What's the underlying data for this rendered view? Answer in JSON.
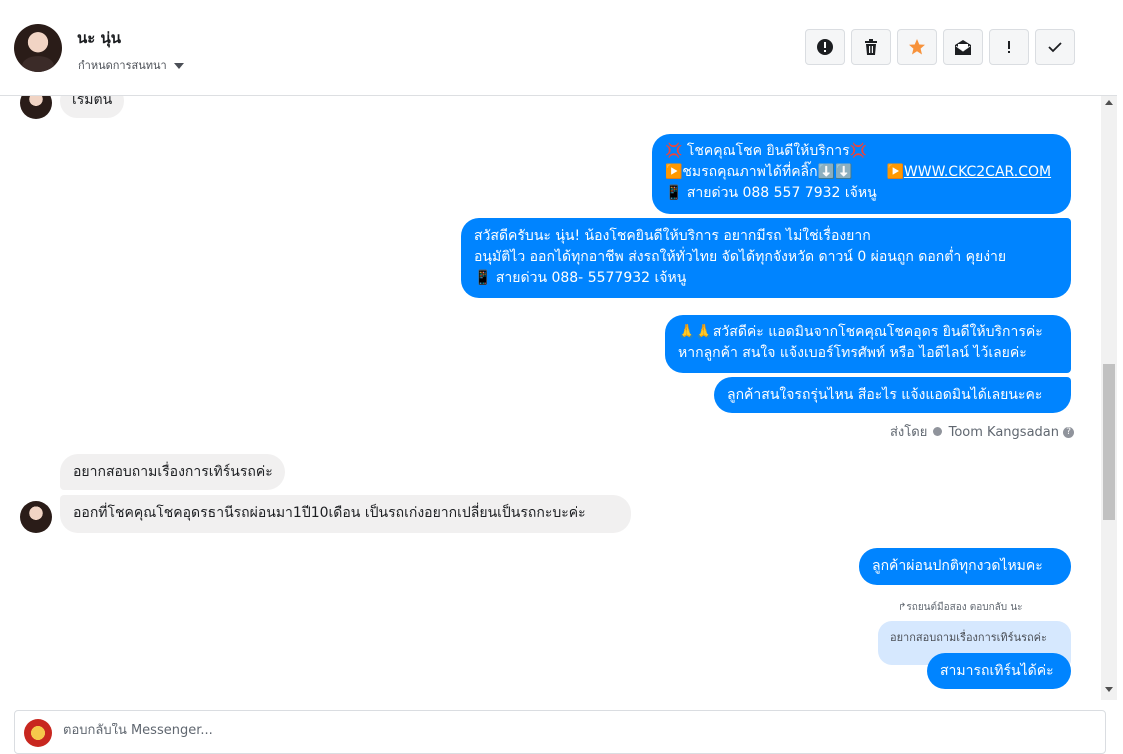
{
  "header": {
    "contact_name": "นะ นุ่น",
    "assign_label": "กำหนดการสนทนา",
    "actions": {
      "spam_icon": "exclamation-circle",
      "delete_icon": "trash",
      "star_icon": "star",
      "unread_icon": "envelope-open",
      "follow_up_icon": "exclamation",
      "done_icon": "check"
    },
    "star_color": "#f7923b"
  },
  "messages": {
    "m0": "เริ่มต้น",
    "m1_l1": "💢 โชคคุณโชค ยินดีให้บริการ💢",
    "m1_l2a": "▶️ชมรถคุณภาพได้ที่คลิ๊ก⬇️⬇️",
    "m1_l2b": "▶️",
    "m1_link": "WWW.CKC2CAR.COM",
    "m1_l3": "📱 สายด่วน 088 557 7932 เจ้หนู",
    "m2_l1": "สวัสดีครับนะ นุ่น! น้องโชคยินดีให้บริการ อยากมีรถ ไม่ใช่เรื่องยาก",
    "m2_l2": "อนุมัติไว ออกได้ทุกอาชีพ ส่งรถให้ทั่วไทย จัดได้ทุกจังหวัด ดาวน์ 0  ผ่อนถูก ดอกต่ำ คุยง่าย",
    "m2_l3": "📱 สายด่วน 088- 5577932 เจ้หนู",
    "m3_l1": "🙏🙏สวัสดีค่ะ แอดมินจากโชคคุณโชคอุดร ยินดีให้บริการค่ะ",
    "m3_l2": "หากลูกค้า สนใจ แจ้งเบอร์โทรศัพท์ หรือ ไอดีไลน์  ไว้เลยค่ะ",
    "m4": "ลูกค้าสนใจรถรุ่นไหน สีอะไร แจ้งแอดมินได้เลยนะคะ",
    "sent_by_prefix": "ส่งโดย",
    "sent_by_name": "Toom Kangsadan",
    "m5": "อยากสอบถามเรื่องการเทิร์นรถค่ะ",
    "m6": "ออกที่โชคคุณโชคอุดรธานีรถผ่อนมา1ปี10เดือน เป็นรถเก่งอยากเปลี่ยนเป็นรถกะบะค่ะ",
    "m7": "ลูกค้าผ่อนปกติทุกงวดไหมคะ",
    "reply_note": "รถยนต์มือสอง ตอบกลับ นะ",
    "quoted": "อยากสอบถามเรื่องการเทิร์นรถค่ะ",
    "m8": "สามารถเทิร์นได้ค่ะ"
  },
  "composer": {
    "placeholder": "ตอบกลับใน Messenger..."
  },
  "colors": {
    "outgoing": "#0084ff",
    "incoming": "#f1f0f0"
  }
}
